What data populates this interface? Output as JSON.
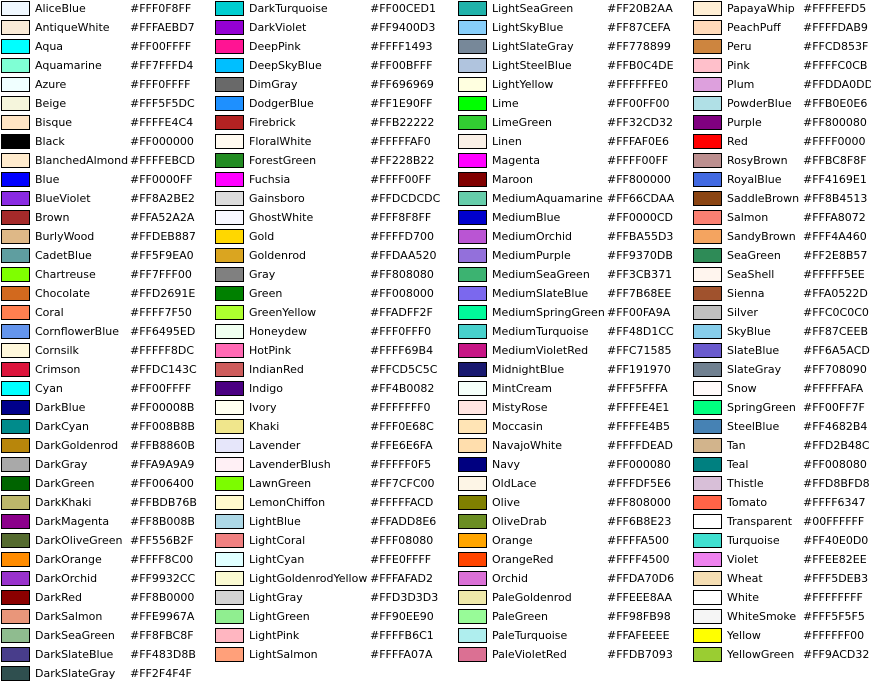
{
  "columns": [
    [
      [
        "AliceBlue",
        "#FFF0F8FF"
      ],
      [
        "AntiqueWhite",
        "#FFFAEBD7"
      ],
      [
        "Aqua",
        "#FF00FFFF"
      ],
      [
        "Aquamarine",
        "#FF7FFFD4"
      ],
      [
        "Azure",
        "#FFF0FFFF"
      ],
      [
        "Beige",
        "#FFF5F5DC"
      ],
      [
        "Bisque",
        "#FFFFE4C4"
      ],
      [
        "Black",
        "#FF000000"
      ],
      [
        "BlanchedAlmond",
        "#FFFFEBCD"
      ],
      [
        "Blue",
        "#FF0000FF"
      ],
      [
        "BlueViolet",
        "#FF8A2BE2"
      ],
      [
        "Brown",
        "#FFA52A2A"
      ],
      [
        "BurlyWood",
        "#FFDEB887"
      ],
      [
        "CadetBlue",
        "#FF5F9EA0"
      ],
      [
        "Chartreuse",
        "#FF7FFF00"
      ],
      [
        "Chocolate",
        "#FFD2691E"
      ],
      [
        "Coral",
        "#FFFF7F50"
      ],
      [
        "CornflowerBlue",
        "#FF6495ED"
      ],
      [
        "Cornsilk",
        "#FFFFF8DC"
      ],
      [
        "Crimson",
        "#FFDC143C"
      ],
      [
        "Cyan",
        "#FF00FFFF"
      ],
      [
        "DarkBlue",
        "#FF00008B"
      ],
      [
        "DarkCyan",
        "#FF008B8B"
      ],
      [
        "DarkGoldenrod",
        "#FFB8860B"
      ],
      [
        "DarkGray",
        "#FFA9A9A9"
      ],
      [
        "DarkGreen",
        "#FF006400"
      ],
      [
        "DarkKhaki",
        "#FFBDB76B"
      ],
      [
        "DarkMagenta",
        "#FF8B008B"
      ],
      [
        "DarkOliveGreen",
        "#FF556B2F"
      ],
      [
        "DarkOrange",
        "#FFFF8C00"
      ],
      [
        "DarkOrchid",
        "#FF9932CC"
      ],
      [
        "DarkRed",
        "#FF8B0000"
      ],
      [
        "DarkSalmon",
        "#FFE9967A"
      ],
      [
        "DarkSeaGreen",
        "#FF8FBC8F"
      ],
      [
        "DarkSlateBlue",
        "#FF483D8B"
      ],
      [
        "DarkSlateGray",
        "#FF2F4F4F"
      ]
    ],
    [
      [
        "DarkTurquoise",
        "#FF00CED1"
      ],
      [
        "DarkViolet",
        "#FF9400D3"
      ],
      [
        "DeepPink",
        "#FFFF1493"
      ],
      [
        "DeepSkyBlue",
        "#FF00BFFF"
      ],
      [
        "DimGray",
        "#FF696969"
      ],
      [
        "DodgerBlue",
        "#FF1E90FF"
      ],
      [
        "Firebrick",
        "#FFB22222"
      ],
      [
        "FloralWhite",
        "#FFFFFAF0"
      ],
      [
        "ForestGreen",
        "#FF228B22"
      ],
      [
        "Fuchsia",
        "#FFFF00FF"
      ],
      [
        "Gainsboro",
        "#FFDCDCDC"
      ],
      [
        "GhostWhite",
        "#FFF8F8FF"
      ],
      [
        "Gold",
        "#FFFFD700"
      ],
      [
        "Goldenrod",
        "#FFDAA520"
      ],
      [
        "Gray",
        "#FF808080"
      ],
      [
        "Green",
        "#FF008000"
      ],
      [
        "GreenYellow",
        "#FFADFF2F"
      ],
      [
        "Honeydew",
        "#FFF0FFF0"
      ],
      [
        "HotPink",
        "#FFFF69B4"
      ],
      [
        "IndianRed",
        "#FFCD5C5C"
      ],
      [
        "Indigo",
        "#FF4B0082"
      ],
      [
        "Ivory",
        "#FFFFFFF0"
      ],
      [
        "Khaki",
        "#FFF0E68C"
      ],
      [
        "Lavender",
        "#FFE6E6FA"
      ],
      [
        "LavenderBlush",
        "#FFFFF0F5"
      ],
      [
        "LawnGreen",
        "#FF7CFC00"
      ],
      [
        "LemonChiffon",
        "#FFFFFACD"
      ],
      [
        "LightBlue",
        "#FFADD8E6"
      ],
      [
        "LightCoral",
        "#FFF08080"
      ],
      [
        "LightCyan",
        "#FFE0FFFF"
      ],
      [
        "LightGoldenrodYellow",
        "#FFFAFAD2"
      ],
      [
        "LightGray",
        "#FFD3D3D3"
      ],
      [
        "LightGreen",
        "#FF90EE90"
      ],
      [
        "LightPink",
        "#FFFFB6C1"
      ],
      [
        "LightSalmon",
        "#FFFFA07A"
      ]
    ],
    [
      [
        "LightSeaGreen",
        "#FF20B2AA"
      ],
      [
        "LightSkyBlue",
        "#FF87CEFA"
      ],
      [
        "LightSlateGray",
        "#FF778899"
      ],
      [
        "LightSteelBlue",
        "#FFB0C4DE"
      ],
      [
        "LightYellow",
        "#FFFFFFE0"
      ],
      [
        "Lime",
        "#FF00FF00"
      ],
      [
        "LimeGreen",
        "#FF32CD32"
      ],
      [
        "Linen",
        "#FFFAF0E6"
      ],
      [
        "Magenta",
        "#FFFF00FF"
      ],
      [
        "Maroon",
        "#FF800000"
      ],
      [
        "MediumAquamarine",
        "#FF66CDAA"
      ],
      [
        "MediumBlue",
        "#FF0000CD"
      ],
      [
        "MediumOrchid",
        "#FFBA55D3"
      ],
      [
        "MediumPurple",
        "#FF9370DB"
      ],
      [
        "MediumSeaGreen",
        "#FF3CB371"
      ],
      [
        "MediumSlateBlue",
        "#FF7B68EE"
      ],
      [
        "MediumSpringGreen",
        "#FF00FA9A"
      ],
      [
        "MediumTurquoise",
        "#FF48D1CC"
      ],
      [
        "MediumVioletRed",
        "#FFC71585"
      ],
      [
        "MidnightBlue",
        "#FF191970"
      ],
      [
        "MintCream",
        "#FFF5FFFA"
      ],
      [
        "MistyRose",
        "#FFFFE4E1"
      ],
      [
        "Moccasin",
        "#FFFFE4B5"
      ],
      [
        "NavajoWhite",
        "#FFFFDEAD"
      ],
      [
        "Navy",
        "#FF000080"
      ],
      [
        "OldLace",
        "#FFFDF5E6"
      ],
      [
        "Olive",
        "#FF808000"
      ],
      [
        "OliveDrab",
        "#FF6B8E23"
      ],
      [
        "Orange",
        "#FFFFA500"
      ],
      [
        "OrangeRed",
        "#FFFF4500"
      ],
      [
        "Orchid",
        "#FFDA70D6"
      ],
      [
        "PaleGoldenrod",
        "#FFEEE8AA"
      ],
      [
        "PaleGreen",
        "#FF98FB98"
      ],
      [
        "PaleTurquoise",
        "#FFAFEEEE"
      ],
      [
        "PaleVioletRed",
        "#FFDB7093"
      ]
    ],
    [
      [
        "PapayaWhip",
        "#FFFFEFD5"
      ],
      [
        "PeachPuff",
        "#FFFFDAB9"
      ],
      [
        "Peru",
        "#FFCD853F"
      ],
      [
        "Pink",
        "#FFFFC0CB"
      ],
      [
        "Plum",
        "#FFDDA0DD"
      ],
      [
        "PowderBlue",
        "#FFB0E0E6"
      ],
      [
        "Purple",
        "#FF800080"
      ],
      [
        "Red",
        "#FFFF0000"
      ],
      [
        "RosyBrown",
        "#FFBC8F8F"
      ],
      [
        "RoyalBlue",
        "#FF4169E1"
      ],
      [
        "SaddleBrown",
        "#FF8B4513"
      ],
      [
        "Salmon",
        "#FFFA8072"
      ],
      [
        "SandyBrown",
        "#FFF4A460"
      ],
      [
        "SeaGreen",
        "#FF2E8B57"
      ],
      [
        "SeaShell",
        "#FFFFF5EE"
      ],
      [
        "Sienna",
        "#FFA0522D"
      ],
      [
        "Silver",
        "#FFC0C0C0"
      ],
      [
        "SkyBlue",
        "#FF87CEEB"
      ],
      [
        "SlateBlue",
        "#FF6A5ACD"
      ],
      [
        "SlateGray",
        "#FF708090"
      ],
      [
        "Snow",
        "#FFFFFAFA"
      ],
      [
        "SpringGreen",
        "#FF00FF7F"
      ],
      [
        "SteelBlue",
        "#FF4682B4"
      ],
      [
        "Tan",
        "#FFD2B48C"
      ],
      [
        "Teal",
        "#FF008080"
      ],
      [
        "Thistle",
        "#FFD8BFD8"
      ],
      [
        "Tomato",
        "#FFFF6347"
      ],
      [
        "Transparent",
        "#00FFFFFF"
      ],
      [
        "Turquoise",
        "#FF40E0D0"
      ],
      [
        "Violet",
        "#FFEE82EE"
      ],
      [
        "Wheat",
        "#FFF5DEB3"
      ],
      [
        "White",
        "#FFFFFFFF"
      ],
      [
        "WhiteSmoke",
        "#FFF5F5F5"
      ],
      [
        "Yellow",
        "#FFFFFF00"
      ],
      [
        "YellowGreen",
        "#FF9ACD32"
      ]
    ]
  ]
}
